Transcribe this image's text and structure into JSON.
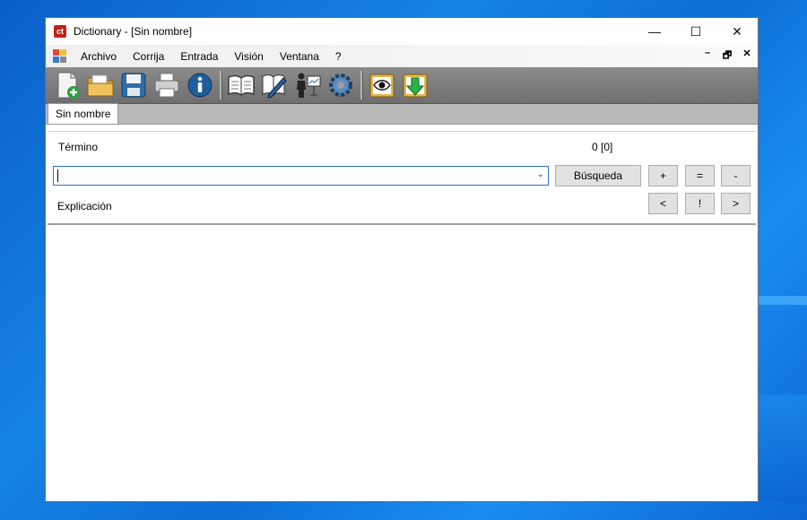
{
  "window": {
    "title": "Dictionary - [Sin nombre]",
    "app_icon_text": "ct",
    "controls": {
      "minimize": "—",
      "maximize": "☐",
      "close": "✕"
    }
  },
  "menubar": {
    "items": [
      {
        "label": "Archivo"
      },
      {
        "label": "Corrija"
      },
      {
        "label": "Entrada"
      },
      {
        "label": "Visión"
      },
      {
        "label": "Ventana"
      },
      {
        "label": "?"
      }
    ],
    "mdi_controls": {
      "minimize": "–",
      "restore": "🗗",
      "close": "✕"
    }
  },
  "toolbar": {
    "icons": [
      "new-document-icon",
      "open-folder-icon",
      "save-icon",
      "print-icon",
      "info-icon",
      "book-icon",
      "edit-entry-icon",
      "presentation-icon",
      "settings-gear-icon",
      "preview-eye-icon",
      "download-icon"
    ]
  },
  "tabs": [
    {
      "label": "Sin nombre"
    }
  ],
  "form": {
    "term_label": "Término",
    "count": "0 [0]",
    "search_value": "",
    "search_button": "Búsqueda",
    "add_button": "+",
    "equal_button": "=",
    "minus_button": "-",
    "explanation_label": "Explicación",
    "prev_button": "<",
    "bang_button": "!",
    "next_button": ">"
  },
  "explanation_text": ""
}
